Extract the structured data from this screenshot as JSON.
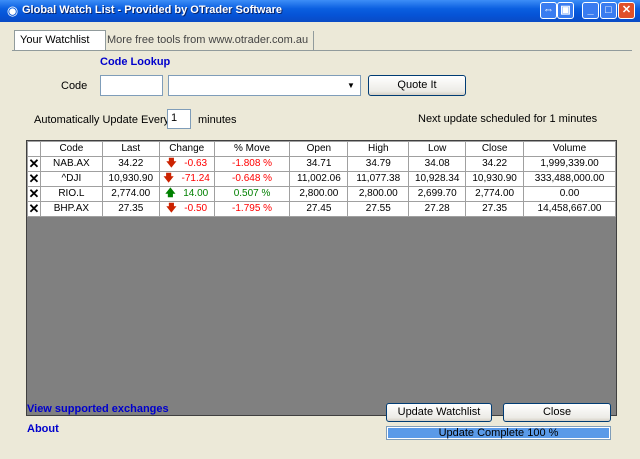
{
  "window": {
    "title": "Global Watch List - Provided by OTrader Software",
    "icon": "globe-icon",
    "buttons": [
      "pin-icon",
      "restore-icon",
      "minimize-icon",
      "maximize-icon",
      "close-icon"
    ]
  },
  "tabs": [
    {
      "label": "Your Watchlist",
      "active": true
    },
    {
      "label": "More free tools from www.otrader.com.au",
      "active": false
    }
  ],
  "lookup": {
    "title": "Code Lookup",
    "code_label": "Code",
    "code_value": "",
    "combo_value": "",
    "quote_button": "Quote It"
  },
  "auto_update": {
    "label": "Automatically Update Every",
    "interval": "1",
    "unit": "minutes",
    "next_update": "Next update scheduled for 1 minutes"
  },
  "grid": {
    "columns": [
      "Code",
      "Last",
      "Change",
      "% Move",
      "Open",
      "High",
      "Low",
      "Close",
      "Volume"
    ],
    "rows": [
      {
        "code": "NAB.AX",
        "last": "34.22",
        "direction": "down",
        "change": "-0.63",
        "move": "-1.808 %",
        "open": "34.71",
        "high": "34.79",
        "low": "34.08",
        "close": "34.22",
        "volume": "1,999,339.00"
      },
      {
        "code": "^DJI",
        "last": "10,930.90",
        "direction": "down",
        "change": "-71.24",
        "move": "-0.648 %",
        "open": "11,002.06",
        "high": "11,077.38",
        "low": "10,928.34",
        "close": "10,930.90",
        "volume": "333,488,000.00"
      },
      {
        "code": "RIO.L",
        "last": "2,774.00",
        "direction": "up",
        "change": "14.00",
        "move": "0.507 %",
        "open": "2,800.00",
        "high": "2,800.00",
        "low": "2,699.70",
        "close": "2,774.00",
        "volume": "0.00"
      },
      {
        "code": "BHP.AX",
        "last": "27.35",
        "direction": "down",
        "change": "-0.50",
        "move": "-1.795 %",
        "open": "27.45",
        "high": "27.55",
        "low": "27.28",
        "close": "27.35",
        "volume": "14,458,667.00"
      }
    ]
  },
  "links": {
    "exchanges": "View supported exchanges",
    "about": "About"
  },
  "footer": {
    "update_button": "Update Watchlist",
    "close_button": "Close",
    "progress_text": "Update Complete 100 %",
    "progress_fraction": 1.0
  },
  "colors": {
    "title_bar": "#0a5fe0",
    "link": "#0000cc",
    "negative": "#ff0000",
    "positive": "#008000",
    "progress": "#5a9ae8"
  }
}
